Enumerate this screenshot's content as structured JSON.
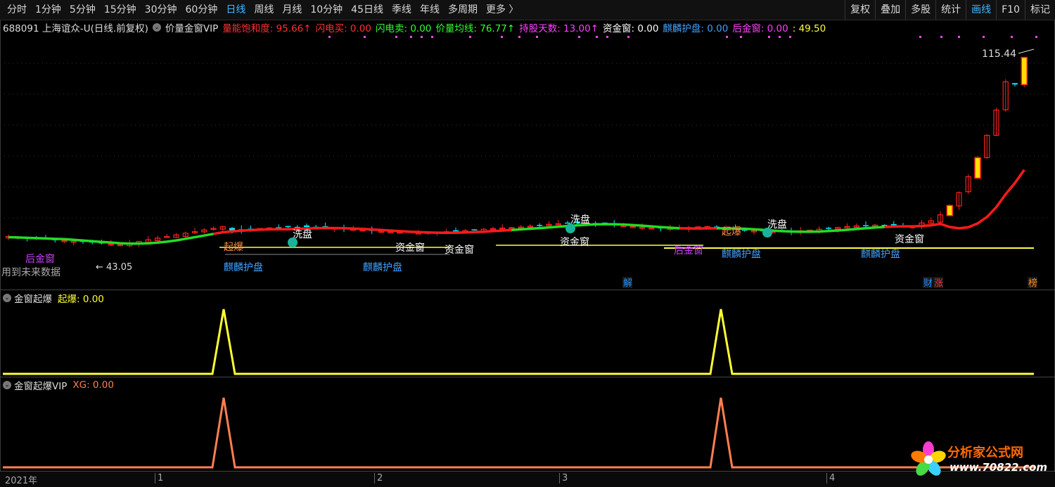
{
  "toolbar": {
    "tabs": [
      "分时",
      "1分钟",
      "5分钟",
      "15分钟",
      "30分钟",
      "60分钟",
      "日线",
      "周线",
      "月线",
      "10分钟",
      "45日线",
      "季线",
      "年线",
      "多周期",
      "更多 〉"
    ],
    "active_tab": "日线",
    "right_tools": [
      "复权",
      "叠加",
      "多股",
      "统计",
      "画线",
      "F10",
      "标记"
    ],
    "active_right": "画线"
  },
  "info": {
    "stock": "688091 上海谊众-U(日线.前复权)",
    "indicator": "价量金窗VIP",
    "items": [
      {
        "label": "量能饱和度: 95.66↑",
        "color": "#ff3030"
      },
      {
        "label": "闪电买: 0.00",
        "color": "#ff3030"
      },
      {
        "label": "闪电卖: 0.00",
        "color": "#33ff33"
      },
      {
        "label": "价量均线: 76.77↑",
        "color": "#33ff33"
      },
      {
        "label": "持股天数: 13.00↑",
        "color": "#ff40ff"
      },
      {
        "label": "资金窗: 0.00",
        "color": "#ffffff"
      },
      {
        "label": "麒麟护盘: 0.00",
        "color": "#3fa0ff"
      },
      {
        "label": "后金窗: 0.00",
        "color": "#ff40ff"
      },
      {
        "label": ": 49.50",
        "color": "#ffff40"
      }
    ]
  },
  "main_chart": {
    "price_high": "115.44",
    "price_low": "43.05",
    "future_data_note": "用到未来数据",
    "labels": {
      "xipan": "洗盘",
      "qibao": "起爆",
      "zijinchuang": "资金窗",
      "qilin": "麒麟护盘",
      "houjinchuang": "后金窗"
    },
    "badges": [
      "解",
      "财",
      "涨",
      "榜"
    ]
  },
  "panel1": {
    "name": "金窗起爆",
    "value_label": "起爆: 0.00",
    "color": "#ffff33"
  },
  "panel2": {
    "name": "金窗起爆VIP",
    "value_label": "XG: 0.00",
    "color": "#ff7f50"
  },
  "xaxis": {
    "labels": [
      "2021年",
      "1",
      "2",
      "3",
      "4"
    ]
  },
  "logo": {
    "title": "分析家公式网",
    "url": "www.70822.com"
  },
  "colors": {
    "up": "#ff2020",
    "down": "#00ffff",
    "ma_red": "#ff1a1a",
    "ma_green": "#22dd22",
    "support": "#ffff40"
  },
  "chart_data": {
    "type": "candlestick",
    "series": [
      {
        "name": "起爆",
        "values": [
          0,
          0,
          1,
          0,
          0,
          0,
          1,
          0,
          0
        ]
      },
      {
        "name": "XG",
        "values": [
          0,
          0,
          1,
          0,
          0,
          0,
          1,
          0,
          0
        ]
      }
    ]
  }
}
